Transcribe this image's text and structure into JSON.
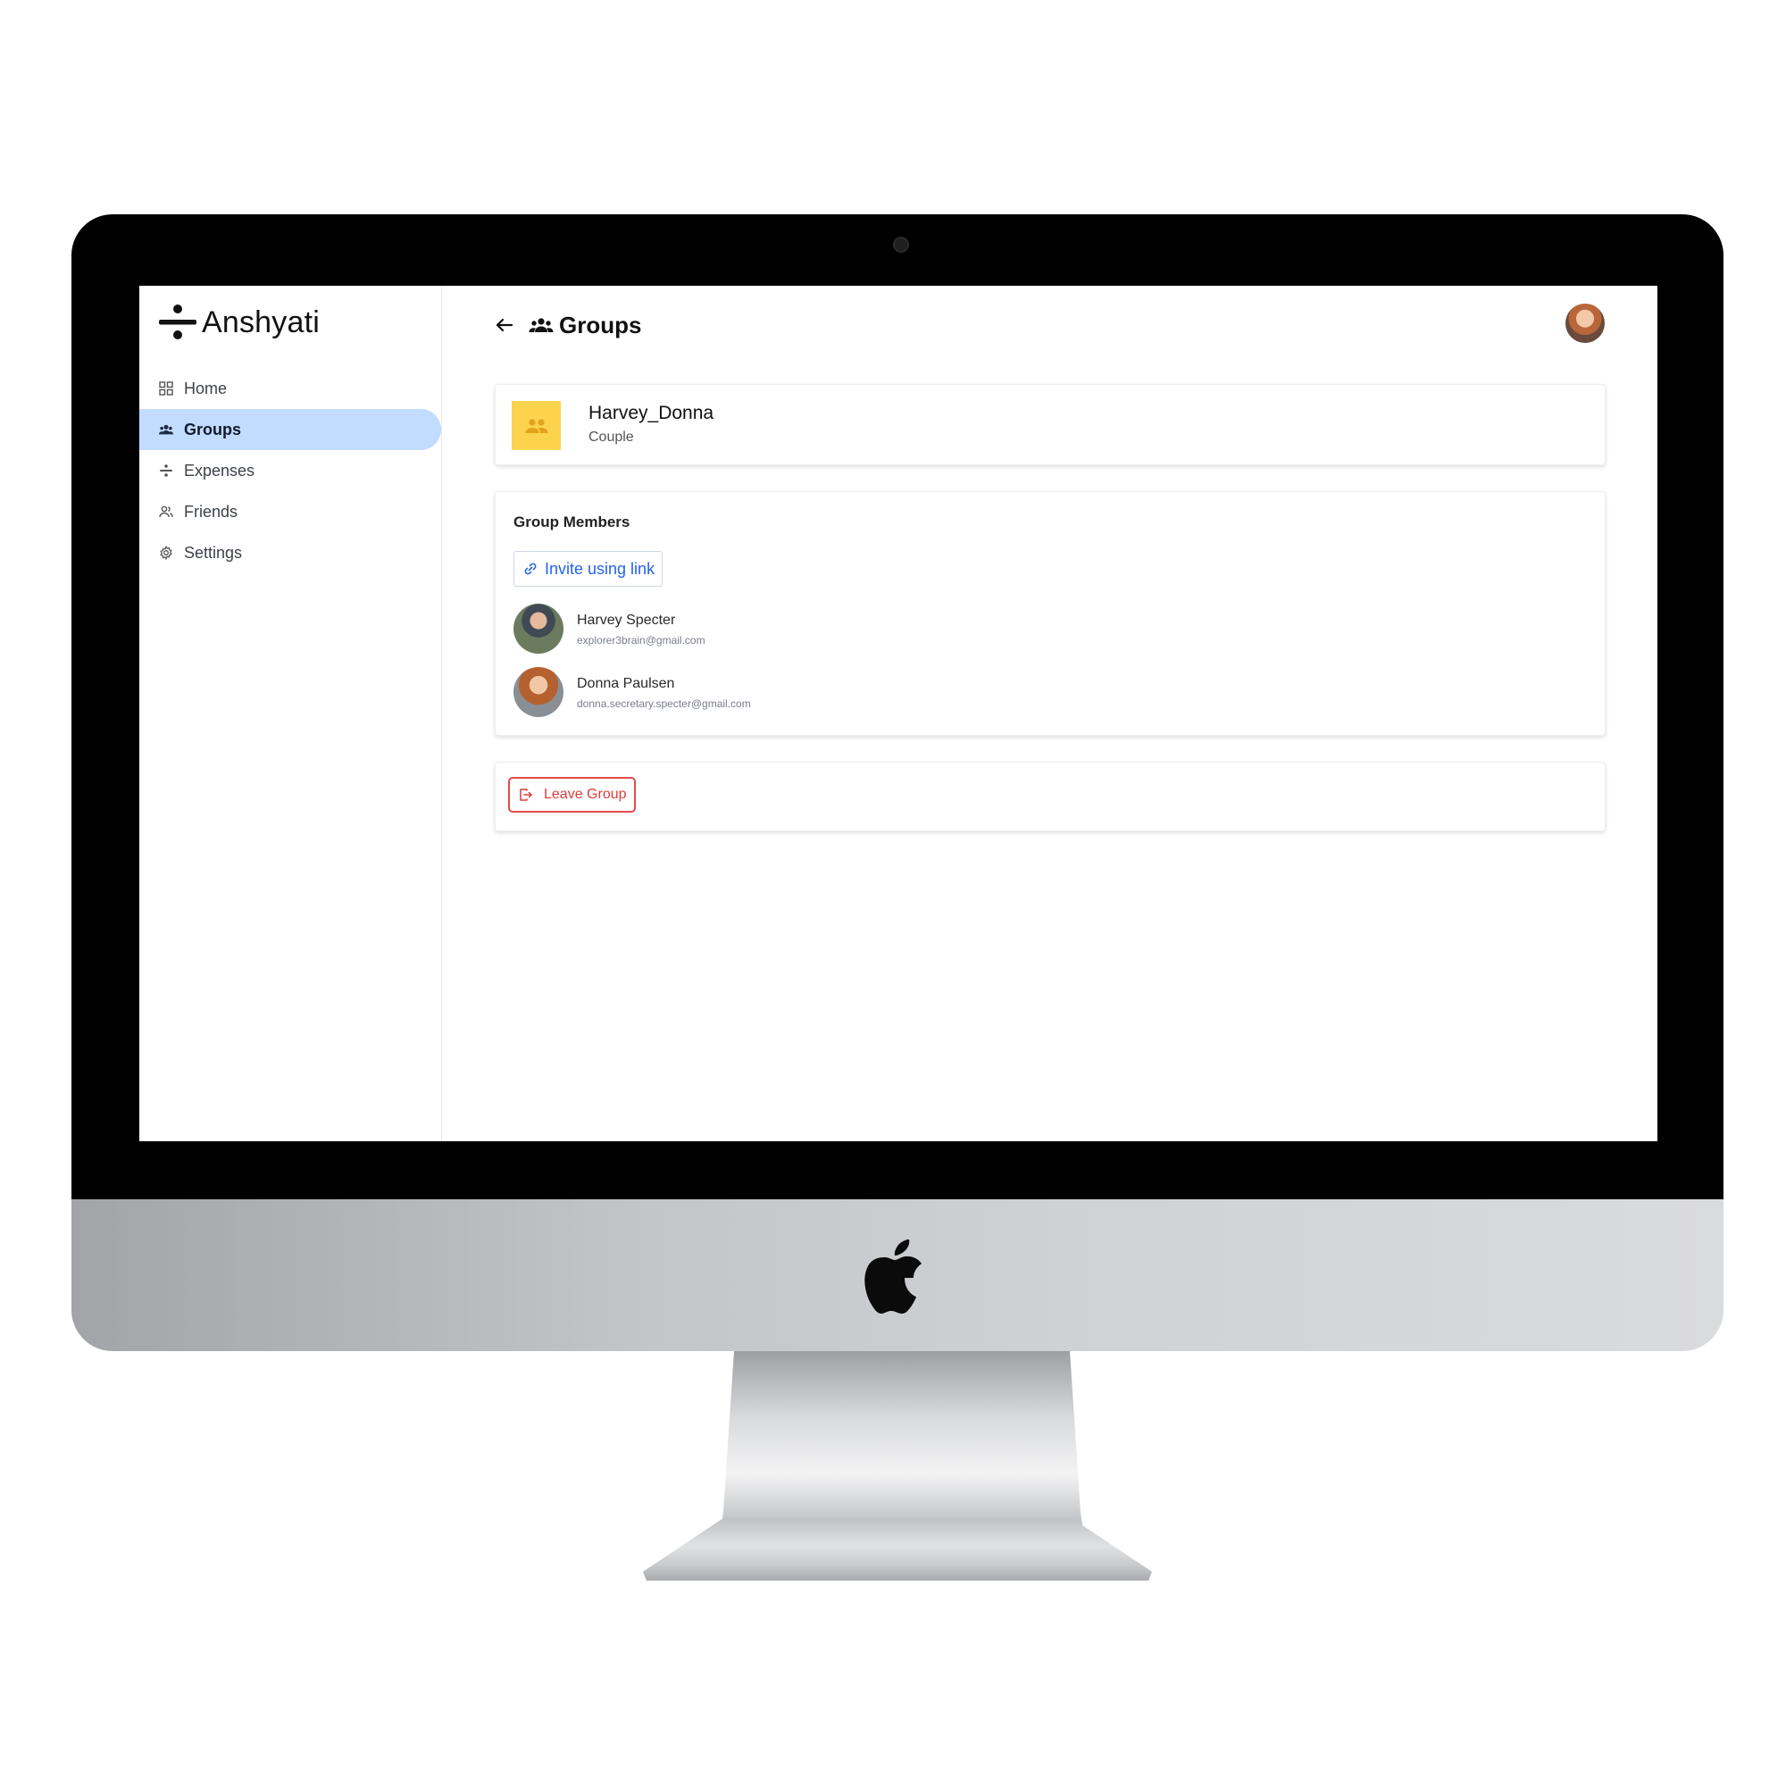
{
  "app": {
    "name": "Anshyati",
    "accent_color": "#c2dcff",
    "group_thumb_color": "#fcd34d",
    "danger_color": "#e24b4b",
    "link_color": "#2563eb"
  },
  "sidebar": {
    "items": [
      {
        "label": "Home",
        "icon": "grid-icon",
        "active": false
      },
      {
        "label": "Groups",
        "icon": "groups-icon",
        "active": true
      },
      {
        "label": "Expenses",
        "icon": "divide-icon",
        "active": false
      },
      {
        "label": "Friends",
        "icon": "friends-icon",
        "active": false
      },
      {
        "label": "Settings",
        "icon": "gear-icon",
        "active": false
      }
    ]
  },
  "header": {
    "title": "Groups",
    "back_icon": "arrow-left-icon",
    "title_icon": "groups-icon",
    "avatar": "user-avatar"
  },
  "group": {
    "name": "Harvey_Donna",
    "type": "Couple"
  },
  "members": {
    "section_title": "Group Members",
    "invite_label": "Invite using link",
    "list": [
      {
        "name": "Harvey Specter",
        "email": "explorer3brain@gmail.com"
      },
      {
        "name": "Donna Paulsen",
        "email": "donna.secretary.specter@gmail.com"
      }
    ]
  },
  "actions": {
    "leave_label": "Leave Group"
  }
}
